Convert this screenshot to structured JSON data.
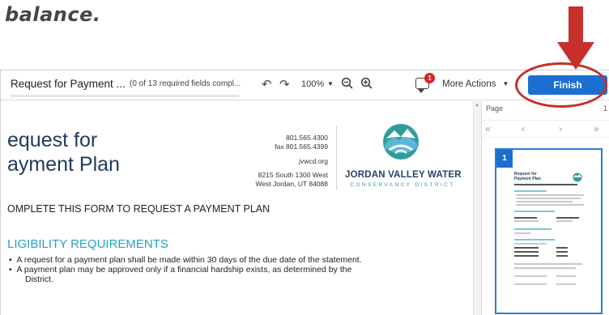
{
  "tutorial": {
    "heading": "balance."
  },
  "toolbar": {
    "doc_title": "Request for Payment ...",
    "field_status": "(0 of 13 required fields compl...",
    "progress_fraction": 0,
    "zoom": "100%",
    "comment_count": "1",
    "more_actions_label": "More Actions",
    "finish_label": "Finish"
  },
  "document": {
    "title_line1": "equest for",
    "title_line2": "ayment Plan",
    "contact_phone": "801.565.4300",
    "contact_fax": "fax 801.565.4399",
    "contact_web": "jvwcd.org",
    "contact_address1": "8215 South 1300 West",
    "contact_address2": "West Jordan, UT 84088",
    "logo_name": "JORDAN VALLEY WATER",
    "logo_sub": "CONSERVANCY DISTRICT",
    "instruction": "OMPLETE THIS FORM TO REQUEST A PAYMENT PLAN",
    "section_heading": "LIGIBILITY REQUIREMENTS",
    "bullet1": "A request for a payment plan shall be made within 30 days of the due date of the statement.",
    "bullet2": "A payment plan may be approved only if a financial hardship exists, as determined by the",
    "bullet2_cont": "District."
  },
  "sidebar": {
    "page_label": "Page",
    "page_number": "1",
    "thumb_page": "1",
    "thumb_title_line1": "Request for",
    "thumb_title_line2": "Payment Plan"
  },
  "colors": {
    "accent": "#1b6fd1",
    "annotation_red": "#c62f2b",
    "section_teal": "#27a0c4",
    "heading_navy": "#1f3a5c"
  },
  "icons": [
    "undo-icon",
    "redo-icon",
    "zoom-out-icon",
    "zoom-in-icon",
    "comment-icon",
    "chevron-down-icon",
    "first-page-icon",
    "prev-page-icon",
    "next-page-icon",
    "last-page-icon",
    "scroll-up-icon"
  ]
}
